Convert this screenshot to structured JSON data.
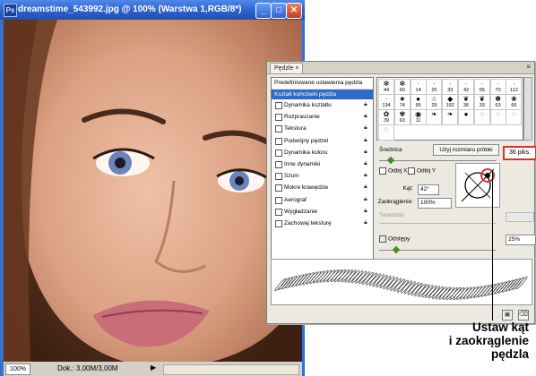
{
  "document": {
    "title": "dreamstime_543992.jpg @ 100% (Warstwa 1,RGB/8*)",
    "zoom": "100%",
    "doc_size": "Dok.: 3,00M/3,00M"
  },
  "brushes_panel": {
    "tab": "Pędzle",
    "presets_header": "Predefiniowane ustawienia pędzla",
    "selected_option": "Kształt końcówki pędzla",
    "options": [
      {
        "label": "Dynamika kształtu"
      },
      {
        "label": "Rozpraszanie"
      },
      {
        "label": "Tekstura"
      },
      {
        "label": "Podwójny pędzel"
      },
      {
        "label": "Dynamika koloru"
      },
      {
        "label": "Inne dynamiki"
      },
      {
        "label": "Szum"
      },
      {
        "label": "Mokre krawędzie"
      },
      {
        "label": "Aerograf"
      },
      {
        "label": "Wygładzanie"
      },
      {
        "label": "Zachowaj teksturę"
      }
    ],
    "brush_presets": [
      {
        "icon": "✻",
        "size": "44"
      },
      {
        "icon": "✻",
        "size": "60"
      },
      {
        "icon": "·",
        "size": "14"
      },
      {
        "icon": "·",
        "size": "26"
      },
      {
        "icon": "·",
        "size": "33"
      },
      {
        "icon": "·",
        "size": "42"
      },
      {
        "icon": "·",
        "size": "55"
      },
      {
        "icon": "·",
        "size": "70"
      },
      {
        "icon": "·",
        "size": "112"
      },
      {
        "icon": "·",
        "size": "134"
      },
      {
        "icon": "★",
        "size": "74"
      },
      {
        "icon": "●",
        "size": "95"
      },
      {
        "icon": "☆",
        "size": "29"
      },
      {
        "icon": "◆",
        "size": "192"
      },
      {
        "icon": "❦",
        "size": "36"
      },
      {
        "icon": "❦",
        "size": "33"
      },
      {
        "icon": "✽",
        "size": "63"
      },
      {
        "icon": "❀",
        "size": "66"
      },
      {
        "icon": "✿",
        "size": "39"
      },
      {
        "icon": "✾",
        "size": "63"
      },
      {
        "icon": "◉",
        "size": "11"
      },
      {
        "icon": "❧",
        "size": ""
      },
      {
        "icon": "❧",
        "size": ""
      },
      {
        "icon": "●",
        "size": ""
      },
      {
        "icon": "◌",
        "size": ""
      },
      {
        "icon": "◌",
        "size": ""
      },
      {
        "icon": "◌",
        "size": ""
      },
      {
        "icon": "◌",
        "size": ""
      }
    ],
    "diameter_label": "Średnica",
    "use_sample_size": "Użyj rozmiaru próbki",
    "diameter_value": "36 piks.",
    "flip_x": "Odbij X",
    "flip_y": "Odbij Y",
    "angle_label": "Kąt:",
    "angle_value": "42°",
    "roundness_label": "Zaokrąglenie:",
    "roundness_value": "100%",
    "hardness_label": "Twardość",
    "spacing_label": "Odstępy",
    "spacing_value": "25%"
  },
  "callout": {
    "line1": "Ustaw kąt",
    "line2": "i zaokrąglenie",
    "line3": "pędzla"
  },
  "colors": {
    "titlebar": "#2a5fc7",
    "selection": "#316ac5",
    "highlight_border": "#e13128",
    "slider_thumb": "#4b8a2a"
  }
}
